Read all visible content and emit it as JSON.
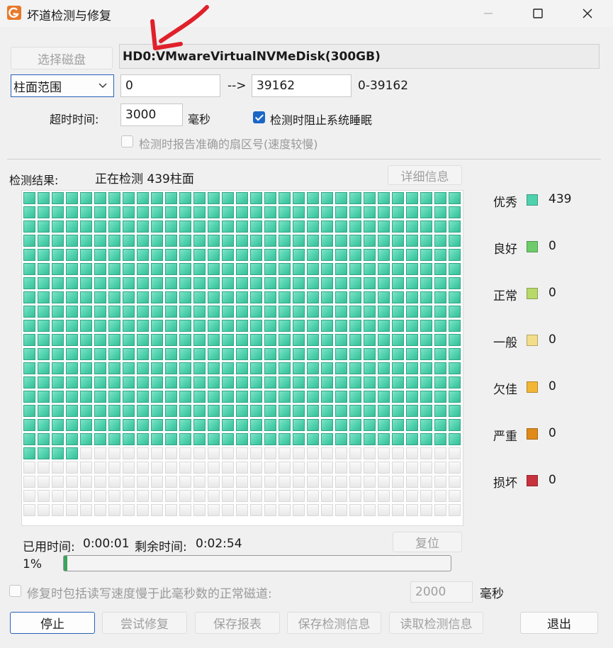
{
  "window": {
    "title": "坏道检测与修复",
    "app_icon": "app-logo-icon"
  },
  "disk": {
    "select_label": "选择磁盘",
    "name": "HD0:VMwareVirtualNVMeDisk(300GB)"
  },
  "range": {
    "mode": "柱面范围",
    "start": "0",
    "arrow": "-->",
    "end": "39162",
    "span": "0-39162"
  },
  "timeout": {
    "label": "超时时间:",
    "value": "3000",
    "unit": "毫秒"
  },
  "options": {
    "prevent_sleep": "检测时阻止系统睡眠",
    "prevent_sleep_checked": true,
    "report_sector": "检测时报告准确的扇区号(速度较慢)",
    "report_sector_checked": false
  },
  "result": {
    "label": "检测结果:",
    "status": "正在检测 439柱面",
    "detail_label": "详细信息"
  },
  "grid": {
    "columns": 31,
    "rows": 23,
    "scanned_cells": 562
  },
  "legend": [
    {
      "label": "优秀",
      "count": "439",
      "color": "#4fd1ae"
    },
    {
      "label": "良好",
      "count": "0",
      "color": "#6ecb6a"
    },
    {
      "label": "正常",
      "count": "0",
      "color": "#b8d86a"
    },
    {
      "label": "一般",
      "count": "0",
      "color": "#f2dd8a"
    },
    {
      "label": "欠佳",
      "count": "0",
      "color": "#f2b636"
    },
    {
      "label": "严重",
      "count": "0",
      "color": "#e08a1a"
    },
    {
      "label": "损坏",
      "count": "0",
      "color": "#c8323c"
    }
  ],
  "timing": {
    "elapsed_label": "已用时间:",
    "elapsed": "0:00:01",
    "remaining_label": "剩余时间:",
    "remaining": "0:02:54",
    "reset_label": "复位"
  },
  "progress": {
    "percent_text": "1%",
    "fraction": 0.01
  },
  "repair": {
    "include_slow_label": "修复时包括读写速度慢于此毫秒数的正常磁道:",
    "include_slow_checked": false,
    "threshold": "2000",
    "unit": "毫秒"
  },
  "buttons": {
    "stop": "停止",
    "try_repair": "尝试修复",
    "save_report": "保存报表",
    "save_info": "保存检测信息",
    "load_info": "读取检测信息",
    "exit": "退出"
  },
  "colors": {
    "accent": "#1a66c6",
    "arrow": "#e0202a"
  }
}
